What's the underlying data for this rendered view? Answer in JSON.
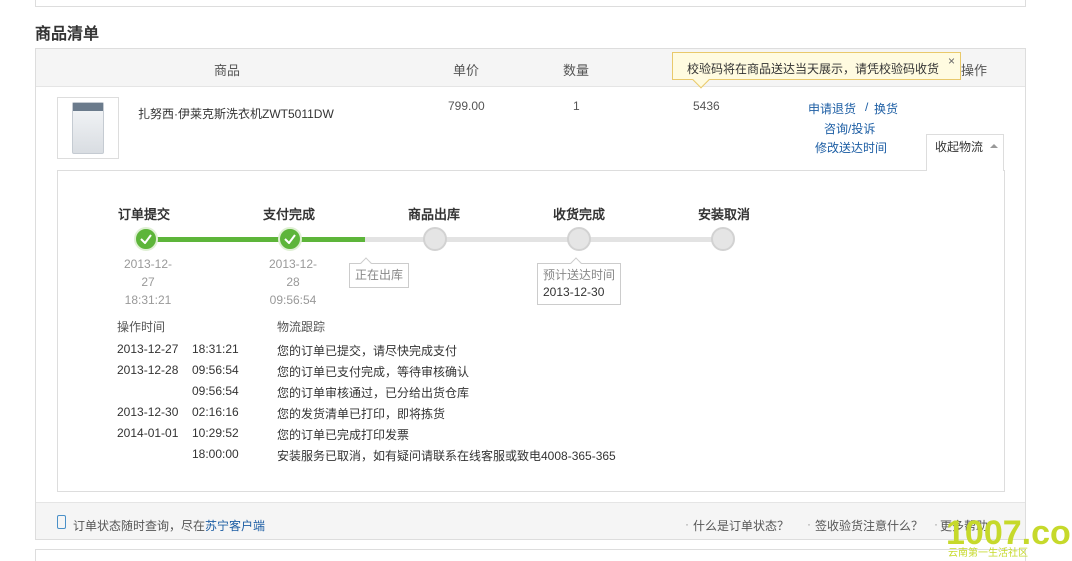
{
  "section_title": "商品清单",
  "table": {
    "headers": {
      "product": "商品",
      "price": "单价",
      "qty": "数量",
      "action_tail": "操作"
    },
    "tooltip": {
      "text": "校验码将在商品送达当天展示，请凭校验码收货",
      "close": "×"
    },
    "row": {
      "name": "扎努西·伊莱克斯洗衣机ZWT5011DW",
      "price": "799.00",
      "qty": "1",
      "code": "5436",
      "actions": {
        "return": "申请退货",
        "sep": "/",
        "exchange": "换货",
        "consult": "咨询/投诉",
        "modify_time": "修改送达时间"
      }
    },
    "collapse_label": "收起物流",
    "collapse_icon": "caret-up-icon"
  },
  "progress": {
    "steps": [
      {
        "label": "订单提交",
        "status": "done",
        "date": "2013-12-27",
        "time": "18:31:21"
      },
      {
        "label": "支付完成",
        "status": "done",
        "date": "2013-12-28",
        "time": "09:56:54"
      },
      {
        "label": "商品出库",
        "status": "todo"
      },
      {
        "label": "收货完成",
        "status": "todo"
      },
      {
        "label": "安装取消",
        "status": "todo"
      }
    ],
    "current_note": "正在出库",
    "eta_label": "预计送达时间",
    "eta_date": "2013-12-30",
    "colors": {
      "done": "#5db53a",
      "todo": "#e5e5e5"
    }
  },
  "log": {
    "headers": {
      "time": "操作时间",
      "track": "物流跟踪"
    },
    "rows": [
      {
        "date": "2013-12-27",
        "time": "18:31:21",
        "text": "您的订单已提交，请尽快完成支付"
      },
      {
        "date": "2013-12-28",
        "time": "09:56:54",
        "text": "您的订单已支付完成，等待审核确认"
      },
      {
        "date": "",
        "time": "09:56:54",
        "text": "您的订单审核通过，已分给出货仓库"
      },
      {
        "date": "2013-12-30",
        "time": "02:16:16",
        "text": "您的发货清单已打印，即将拣货"
      },
      {
        "date": "2014-01-01",
        "time": "10:29:52",
        "text": "您的订单已完成打印发票"
      },
      {
        "date": "",
        "time": "18:00:00",
        "text": "安装服务已取消，如有疑问请联系在线客服或致电4008-365-365"
      }
    ]
  },
  "footer": {
    "query_text": "订单状态随时查询，尽在",
    "client_link": "苏宁客户端",
    "links": [
      "什么是订单状态？",
      "签收验货注意什么？",
      "更多帮助"
    ],
    "link_prefix": "·"
  },
  "watermark": {
    "brand": "1007.com",
    "sub": "云南第一生活社区"
  }
}
